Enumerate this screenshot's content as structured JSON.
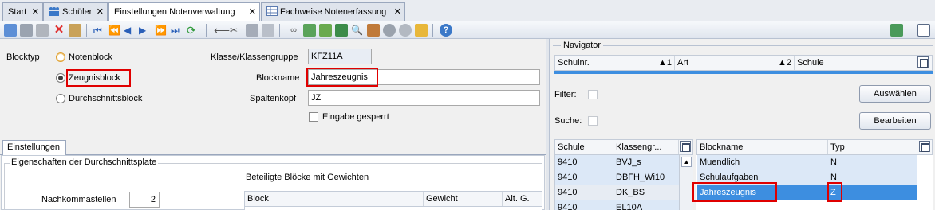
{
  "tabs": [
    {
      "label": "Start",
      "active": false
    },
    {
      "label": "Schüler",
      "active": false,
      "icon": "students-icon"
    },
    {
      "label": "Einstellungen Notenverwaltung",
      "active": true
    },
    {
      "label": "Fachweise Notenerfassung",
      "active": false,
      "icon": "grid-icon"
    }
  ],
  "tab_close": "✕",
  "form": {
    "blocktyp_label": "Blocktyp",
    "radio_notenblock": "Notenblock",
    "radio_zeugnisblock": "Zeugnisblock",
    "radio_durchschnittsblock": "Durchschnittsblock",
    "selected_blocktyp": "Zeugnisblock",
    "klasse_label": "Klasse/Klassengruppe",
    "klasse_value": "KFZ11A",
    "blockname_label": "Blockname",
    "blockname_value": "Jahreszeugnis",
    "spaltenkopf_label": "Spaltenkopf",
    "spaltenkopf_value": "JZ",
    "eingabe_gesperrt_label": "Eingabe gesperrt",
    "eingabe_gesperrt_checked": false
  },
  "settings": {
    "tab_label": "Einstellungen",
    "group_title": "Eigenschaften der Durchschnittsplate",
    "nachkommastellen_label": "Nachkommastellen",
    "nachkommastellen_value": "2",
    "beteiligte_title": "Beteiligte Blöcke mit Gewichten",
    "columns": [
      "Block",
      "Gewicht",
      "Alt. G."
    ]
  },
  "navigator": {
    "title": "Navigator",
    "columns": [
      {
        "label": "Schulnr.",
        "sort": "▲1"
      },
      {
        "label": "Art",
        "sort": "▲2"
      },
      {
        "label": "Schule",
        "sort": ""
      }
    ],
    "filter_label": "Filter:",
    "suche_label": "Suche:",
    "auswaehlen_label": "Auswählen",
    "bearbeiten_label": "Bearbeiten"
  },
  "schule_grid": {
    "columns": [
      "Schule",
      "Klassengr..."
    ],
    "rows": [
      {
        "schule": "9410",
        "klasse": "BVJ_s"
      },
      {
        "schule": "9410",
        "klasse": "DBFH_Wi10"
      },
      {
        "schule": "9410",
        "klasse": "DK_BS"
      },
      {
        "schule": "9410",
        "klasse": "EL10A"
      }
    ]
  },
  "block_grid": {
    "columns": [
      "Blockname",
      "Typ"
    ],
    "rows": [
      {
        "name": "Muendlich",
        "typ": "N",
        "selected": false
      },
      {
        "name": "Schulaufgaben",
        "typ": "N",
        "selected": false
      },
      {
        "name": "Jahreszeugnis",
        "typ": "Z",
        "selected": true
      }
    ]
  },
  "colors": {
    "highlight_red": "#e00000",
    "selection_blue": "#3d8ee0",
    "row_blue": "#dce8f7"
  }
}
